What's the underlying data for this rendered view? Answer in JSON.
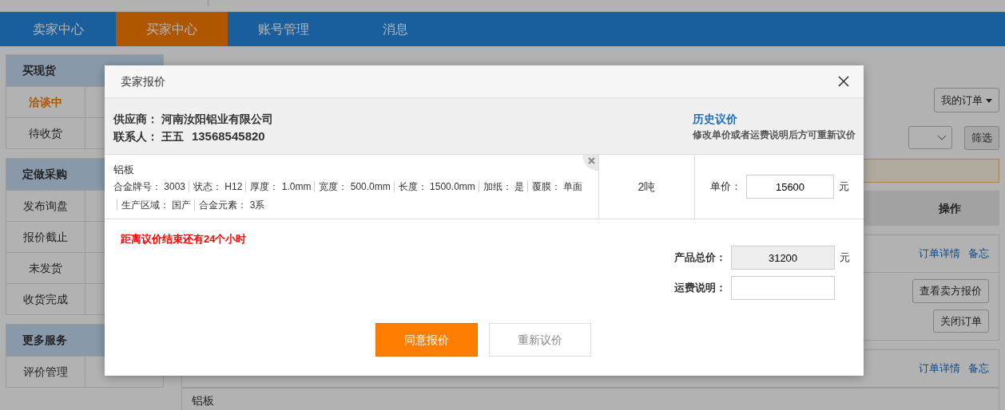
{
  "nav": {
    "tabs": [
      {
        "label": "卖家中心",
        "selected": false
      },
      {
        "label": "买家中心",
        "selected": true
      },
      {
        "label": "账号管理",
        "selected": false
      },
      {
        "label": "消息",
        "selected": false
      }
    ]
  },
  "sidebar": {
    "groups": [
      {
        "title": "买现货",
        "items": [
          {
            "label": "洽谈中",
            "selected": true
          },
          {
            "label": "待收货",
            "selected": false
          }
        ]
      },
      {
        "title": "定做采购",
        "items": [
          {
            "label": "发布询盘",
            "selected": false
          },
          {
            "label": "报价截止",
            "selected": false
          },
          {
            "label": "未发货",
            "selected": false
          },
          {
            "label": "收货完成",
            "selected": false
          }
        ]
      },
      {
        "title": "更多服务",
        "items": [
          {
            "label": "评价管理",
            "selected": false
          }
        ]
      }
    ]
  },
  "orders": {
    "my_orders_button": "我的订单",
    "filter_button": "筛选",
    "table_header": "操作",
    "rows": [
      {
        "links": [
          "订单详情",
          "备忘"
        ],
        "buttons": [
          "查看卖方报价",
          "关闭订单"
        ]
      },
      {
        "links": [
          "订单详情",
          "备忘"
        ],
        "buttons": []
      }
    ],
    "partial_row": {
      "column_1": "铝板"
    }
  },
  "dialog": {
    "title": "卖家报价",
    "supplier": {
      "label": "供应商：",
      "value": "河南汝阳铝业有限公司"
    },
    "contact": {
      "label": "联系人：",
      "name": "王五",
      "phone": "13568545820"
    },
    "history_link": "历史议价",
    "hint": "修改单价或者运费说明后方可重新议价",
    "product": {
      "name": "铝板",
      "specs": [
        "合金牌号： 3003",
        "状态： H12",
        "厚度： 1.0mm",
        "宽度： 500.0mm",
        "长度： 1500.0mm",
        "加纸： 是",
        "覆膜： 单面",
        "生产区域： 国产",
        "合金元素： 3系"
      ],
      "quantity": "2吨",
      "unit_price_label": "单价：",
      "unit_price": "15600",
      "unit": "元"
    },
    "countdown": "距离议价结束还有24个小时",
    "total_label": "产品总价：",
    "total": "31200",
    "total_unit": "元",
    "freight_label": "运费说明：",
    "buttons": [
      {
        "label": "同意报价",
        "kind": "primary"
      },
      {
        "label": "重新议价",
        "kind": "secondary"
      }
    ]
  }
}
